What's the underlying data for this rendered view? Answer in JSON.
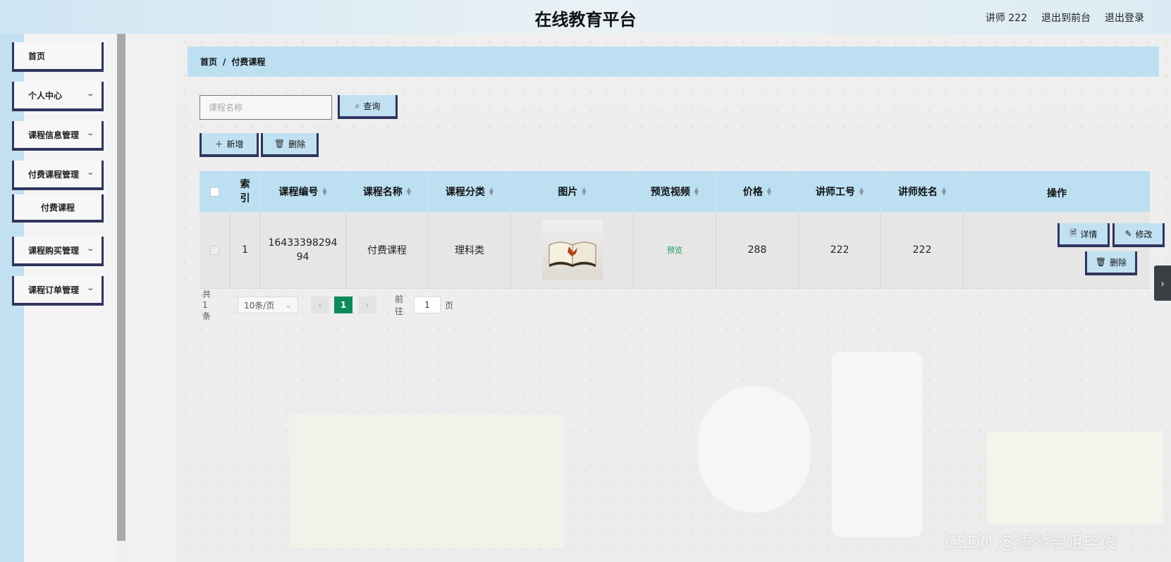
{
  "header": {
    "title": "在线教育平台",
    "user": "讲师 222",
    "front_link": "退出到前台",
    "logout_link": "退出登录"
  },
  "sidebar": {
    "items": [
      {
        "label": "首页"
      },
      {
        "label": "个人中心"
      },
      {
        "label": "课程信息管理"
      },
      {
        "label": "付费课程管理"
      },
      {
        "label": "付费课程"
      },
      {
        "label": "课程购买管理"
      },
      {
        "label": "课程订单管理"
      }
    ]
  },
  "breadcrumb": {
    "home": "首页",
    "sep": "/",
    "current": "付费课程"
  },
  "search": {
    "placeholder": "课程名称",
    "button": "查询"
  },
  "actions": {
    "add": "新增",
    "delete": "删除"
  },
  "table": {
    "columns": [
      "索引",
      "课程编号",
      "课程名称",
      "课程分类",
      "图片",
      "预览视频",
      "价格",
      "讲师工号",
      "讲师姓名",
      "操作"
    ],
    "rows": [
      {
        "index": "1",
        "course_no": "1643339829494",
        "course_name": "付费课程",
        "category": "理科类",
        "preview": "预览",
        "price": "288",
        "teacher_no": "222",
        "teacher_name": "222",
        "ops": {
          "detail": "详情",
          "edit": "修改",
          "delete": "删除"
        }
      }
    ]
  },
  "pager": {
    "total": "共 1 条",
    "page_size": "10条/页",
    "current_page": "1",
    "goto_label": "前往",
    "goto_value": "1",
    "page_unit": "页"
  },
  "watermark": "CSDN @语琴学姐毕设",
  "colors": {
    "header_bg": "#cfe6f3",
    "accent_blue": "#bcdff2",
    "button_border": "#2e355e",
    "active_page": "#0e8a5c",
    "preview_link": "#1a9c5e"
  }
}
